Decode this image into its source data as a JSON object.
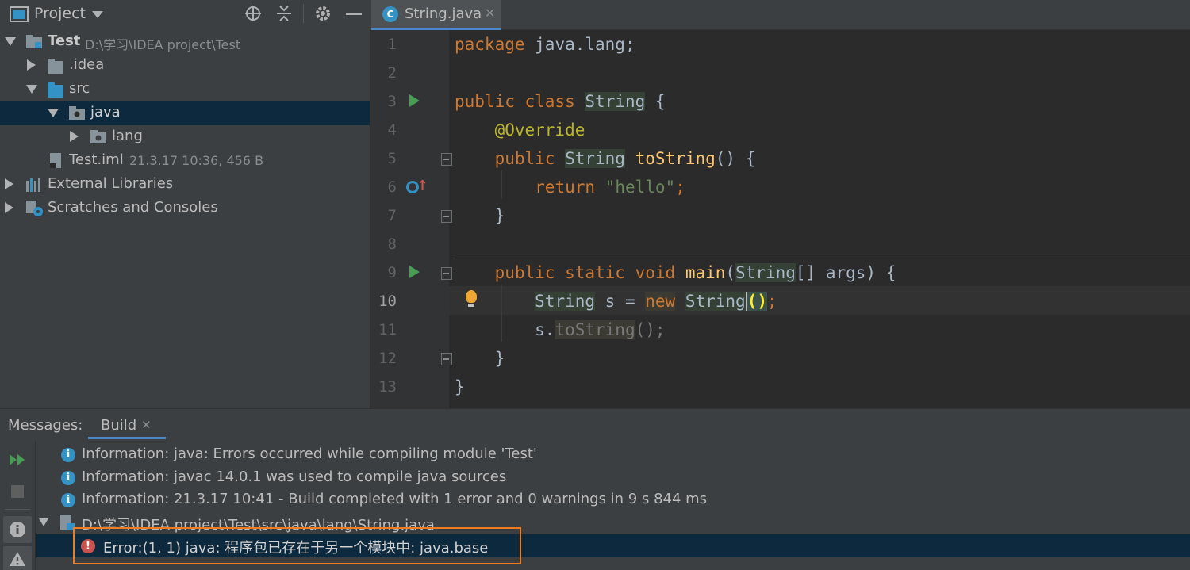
{
  "project_panel": {
    "title": "Project",
    "tree": [
      {
        "label": "Test",
        "meta": "D:\\学习\\IDEA project\\Test"
      },
      {
        "label": ".idea"
      },
      {
        "label": "src"
      },
      {
        "label": "java"
      },
      {
        "label": "lang"
      },
      {
        "label": "Test.iml",
        "meta": "21.3.17 10:36, 456 B"
      },
      {
        "label": "External Libraries"
      },
      {
        "label": "Scratches and Consoles"
      }
    ]
  },
  "editor": {
    "tab_label": "String.java",
    "tab_icon": "C",
    "line_numbers": [
      "1",
      "2",
      "3",
      "4",
      "5",
      "6",
      "7",
      "8",
      "9",
      "10",
      "11",
      "12",
      "13"
    ],
    "code": {
      "l1_kw": "package",
      "l1_rest": " java.lang;",
      "l3_kw": "public class",
      "l3_cls": "String",
      "l3_rest": " {",
      "l4_ann": "@Override",
      "l5_kw": "public",
      "l5_type": "String",
      "l5_fn": "toString",
      "l5_rest": "() {",
      "l6_kw": "return",
      "l6_str": "\"hello\"",
      "l6_semi": ";",
      "l7": "}",
      "l9_kw": "public static void",
      "l9_fn": "main",
      "l9_p1": "(",
      "l9_type": "String",
      "l9_rest": "[] args) {",
      "l10_type": "String",
      "l10_mid": " s = ",
      "l10_kw": "new",
      "l10_type2": "String",
      "l10_paren": "()",
      "l10_semi": ";",
      "l11_s": "s.",
      "l11_fn": "toString",
      "l11_rest": "();",
      "l12": "}",
      "l13": "}"
    }
  },
  "messages": {
    "title": "Messages:",
    "tab_label": "Build",
    "rows": [
      {
        "text": "Information: java: Errors occurred while compiling module 'Test'"
      },
      {
        "text": "Information: javac 14.0.1 was used to compile java sources"
      },
      {
        "text": "Information: 21.3.17 10:41 - Build completed with 1 error and 0 warnings in 9 s 844 ms"
      },
      {
        "text": "D:\\学习\\IDEA project\\Test\\src\\java\\lang\\String.java"
      },
      {
        "text": "Error:(1, 1)  java: 程序包已存在于另一个模块中: java.base"
      }
    ]
  },
  "colors": {
    "accent": "#4a88c7",
    "error": "#c75450",
    "highlight_box": "#f07c21",
    "selection": "#0d293e"
  }
}
